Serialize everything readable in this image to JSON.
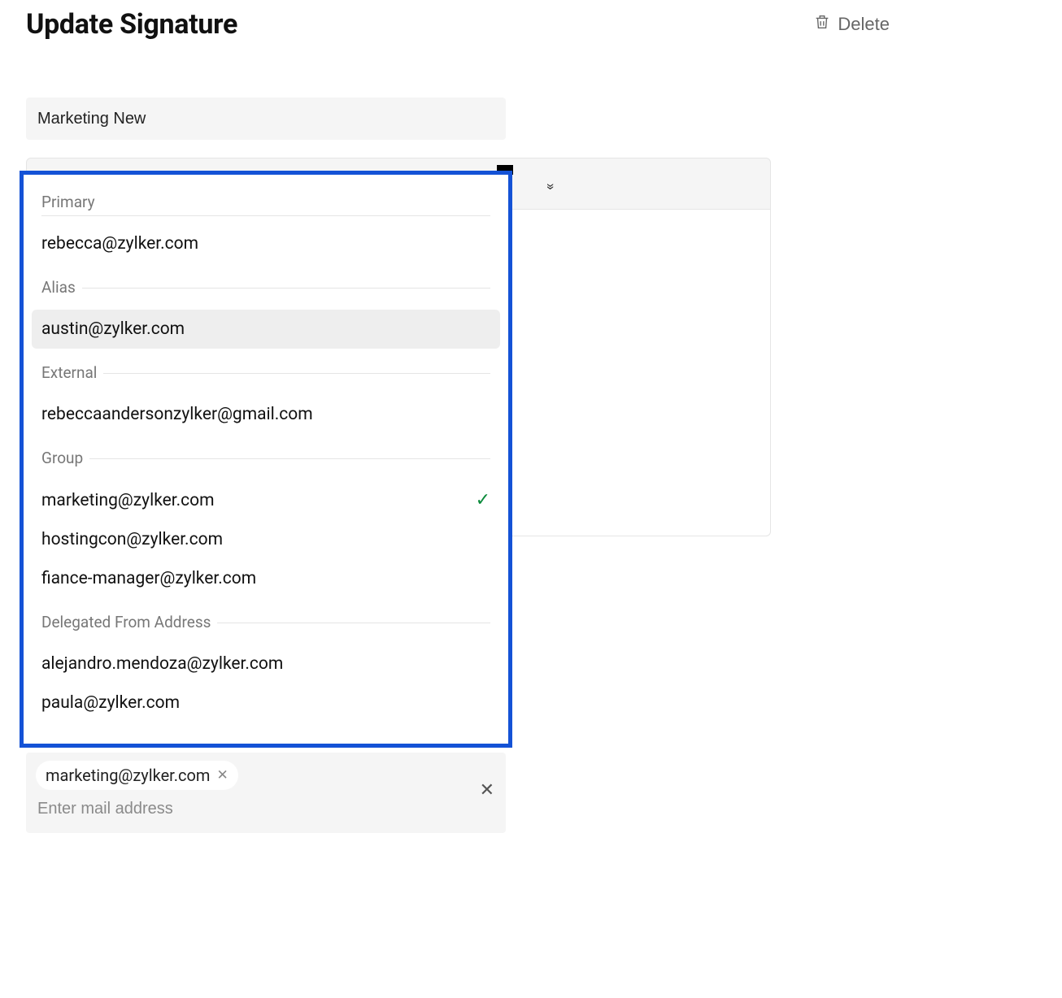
{
  "header": {
    "title": "Update Signature",
    "delete_label": "Delete"
  },
  "name_field": {
    "value": "Marketing New"
  },
  "toolbar": {
    "expand_glyph": "»"
  },
  "dropdown": {
    "groups": [
      {
        "label": "Primary",
        "items": [
          {
            "email": "rebecca@zylker.com",
            "selected": false,
            "hovered": false
          }
        ]
      },
      {
        "label": "Alias",
        "items": [
          {
            "email": "austin@zylker.com",
            "selected": false,
            "hovered": true
          }
        ]
      },
      {
        "label": "External",
        "items": [
          {
            "email": "rebeccaandersonzylker@gmail.com",
            "selected": false,
            "hovered": false
          }
        ]
      },
      {
        "label": "Group",
        "items": [
          {
            "email": "marketing@zylker.com",
            "selected": true,
            "hovered": false
          },
          {
            "email": "hostingcon@zylker.com",
            "selected": false,
            "hovered": false
          },
          {
            "email": "fiance-manager@zylker.com",
            "selected": false,
            "hovered": false
          }
        ]
      },
      {
        "label": "Delegated From Address",
        "items": [
          {
            "email": "alejandro.mendoza@zylker.com",
            "selected": false,
            "hovered": false
          },
          {
            "email": "paula@zylker.com",
            "selected": false,
            "hovered": false
          }
        ]
      }
    ]
  },
  "chips": {
    "items": [
      {
        "email": "marketing@zylker.com"
      }
    ],
    "placeholder": "Enter mail address"
  },
  "glyphs": {
    "check": "✓",
    "close": "✕",
    "small_close": "✕"
  }
}
